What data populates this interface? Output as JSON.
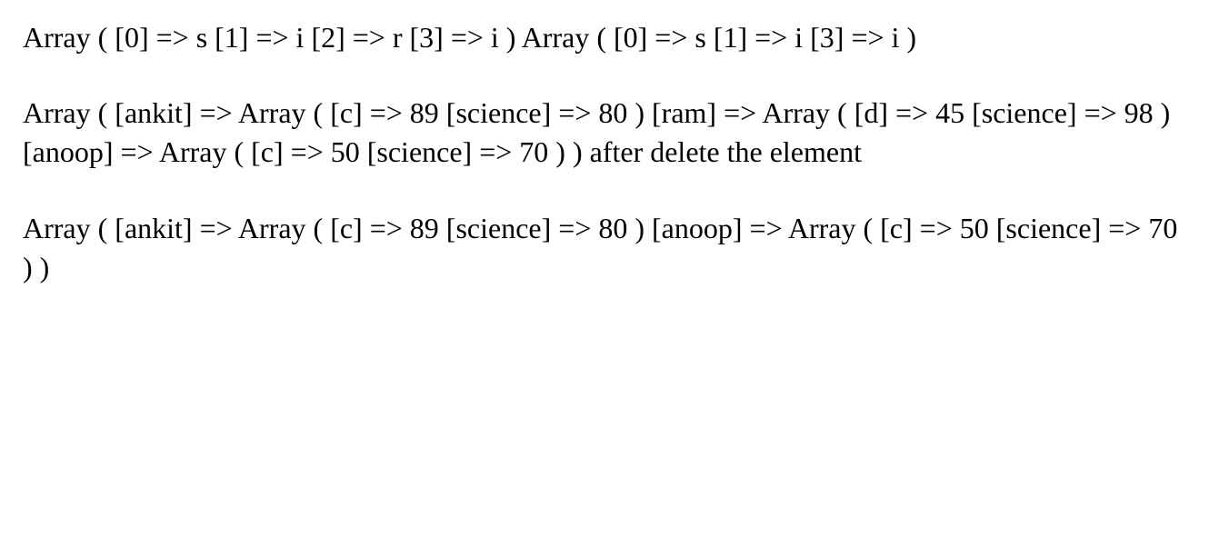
{
  "para1": "Array ( [0] => s [1] => i [2] => r [3] => i ) Array ( [0] => s [1] => i [3] => i )",
  "para2": "Array ( [ankit] => Array ( [c] => 89 [science] => 80 ) [ram] => Array ( [d] => 45 [science] => 98 ) [anoop] => Array ( [c] => 50 [science] => 70 ) ) after delete the element",
  "para3": "Array ( [ankit] => Array ( [c] => 89 [science] => 80 ) [anoop] => Array ( [c] => 50 [science] => 70 ) )"
}
